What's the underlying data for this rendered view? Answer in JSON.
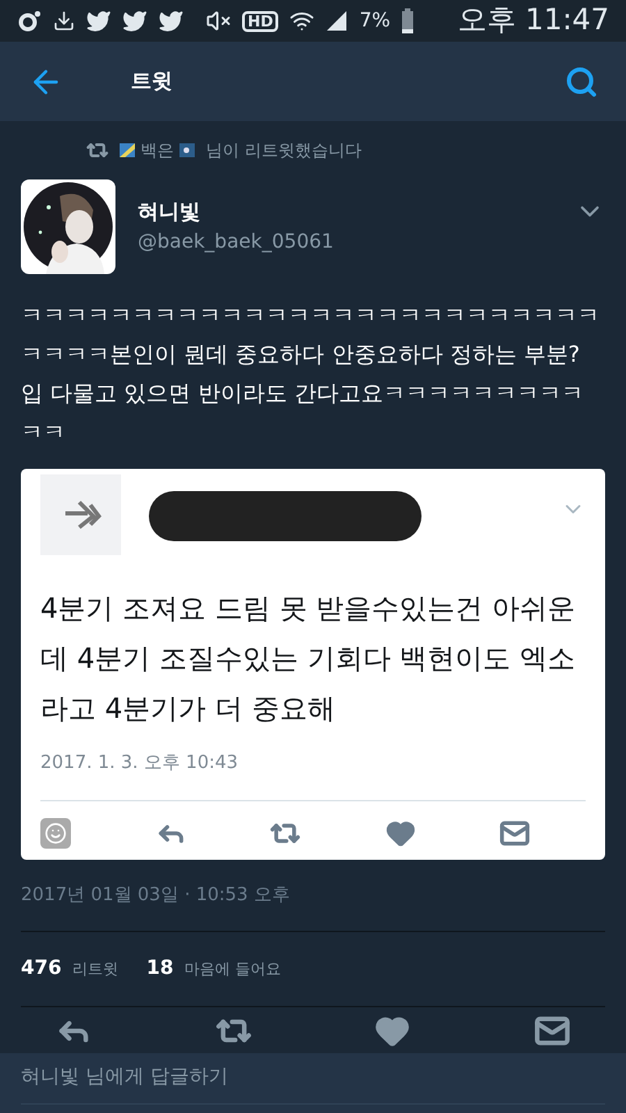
{
  "status_bar": {
    "hd": "HD",
    "battery": "7%",
    "time": "오후 11:47"
  },
  "header": {
    "title": "트윗"
  },
  "retweet_notice": {
    "retweeter": "백은",
    "text": "님이 리트윗했습니다"
  },
  "tweet": {
    "name": "혀니빛",
    "handle": "@baek_baek_05061",
    "text": "ㅋㅋㅋㅋㅋㅋㅋㅋㅋㅋㅋㅋㅋㅋㅋㅋㅋㅋㅋㅋㅋㅋㅋㅋㅋㅋㅋㅋㅋㅋ본인이 뭔데 중요하다 안중요하다 정하는 부분? 입 다물고 있으면 반이라도 간다고요ㅋㅋㅋㅋㅋㅋㅋㅋㅋㅋㅋ",
    "quoted": {
      "text": "4분기 조져요 드림 못 받을수있는건 아쉬운데 4분기 조질수있는 기회다 백현이도 엑소라고 4분기가 더 중요해",
      "date": "2017. 1. 3. 오후 10:43"
    },
    "timestamp": "2017년 01월 03일 · 10:53 오후",
    "stats": [
      {
        "count": "476",
        "label": "리트윗"
      },
      {
        "count": "18",
        "label": "마음에 들어요"
      }
    ]
  },
  "reply_box": {
    "placeholder": "혀니빛 님에게 답글하기"
  }
}
